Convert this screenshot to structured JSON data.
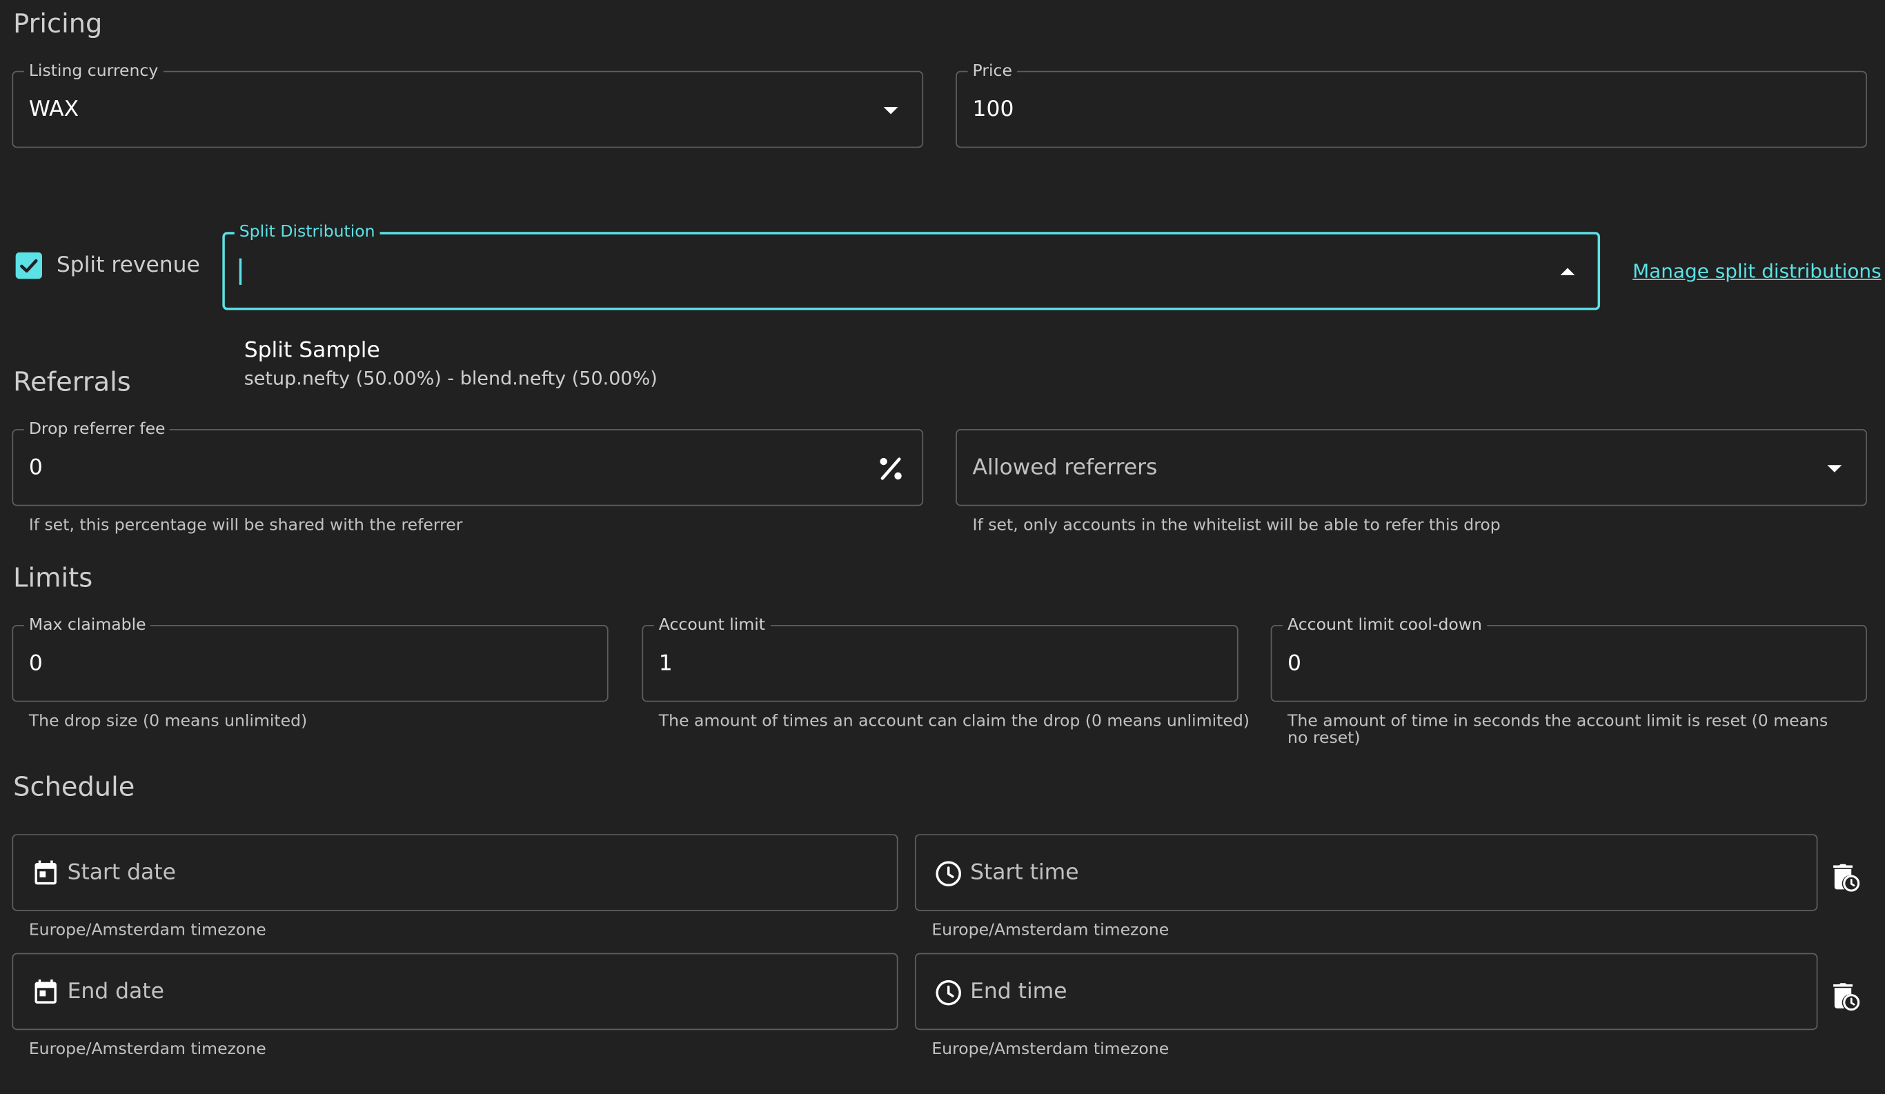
{
  "sections": {
    "pricing": "Pricing",
    "referrals": "Referrals",
    "limits": "Limits",
    "schedule": "Schedule"
  },
  "pricing": {
    "currency_label": "Listing currency",
    "currency_value": "WAX",
    "price_label": "Price",
    "price_value": "100"
  },
  "split": {
    "checkbox_label": "Split revenue",
    "checked": true,
    "distribution_label": "Split Distribution",
    "distribution_value": "",
    "manage_link": "Manage split distributions",
    "options": [
      {
        "title": "Split Sample",
        "subtitle": "setup.nefty (50.00%) - blend.nefty (50.00%)"
      }
    ]
  },
  "referrals": {
    "fee_label": "Drop referrer fee",
    "fee_value": "0",
    "fee_helper": "If set, this percentage will be shared with the referrer",
    "allowed_placeholder": "Allowed referrers",
    "allowed_helper": "If set, only accounts in the whitelist will be able to refer this drop"
  },
  "limits": {
    "max_label": "Max claimable",
    "max_value": "0",
    "max_helper": "The drop size (0 means unlimited)",
    "account_label": "Account limit",
    "account_value": "1",
    "account_helper": "The amount of times an account can claim the drop (0 means unlimited)",
    "cooldown_label": "Account limit cool-down",
    "cooldown_value": "0",
    "cooldown_helper": "The amount of time in seconds the account limit is reset (0 means no reset)"
  },
  "schedule": {
    "start_date_placeholder": "Start date",
    "start_time_placeholder": "Start time",
    "end_date_placeholder": "End date",
    "end_time_placeholder": "End time",
    "timezone_helper": "Europe/Amsterdam timezone"
  },
  "colors": {
    "background": "#212121",
    "accent": "#5ce1e6",
    "border": "rgba(255,255,255,0.28)"
  },
  "icons": {
    "currency_dropdown": "chevron-down-icon",
    "distribution_dropdown": "chevron-up-icon",
    "fee_adornment": "percent-icon",
    "referrers_dropdown": "chevron-down-icon",
    "date_fields": "calendar-icon",
    "time_fields": "clock-icon",
    "clear_buttons": "delete-clock-icon"
  }
}
